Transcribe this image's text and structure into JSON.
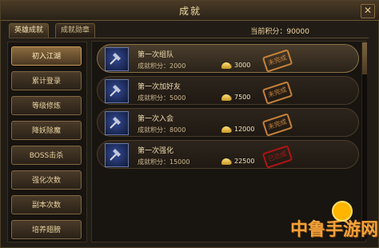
{
  "window": {
    "title": "成就"
  },
  "tabs": [
    {
      "label": "英雄成就"
    },
    {
      "label": "成就勋章"
    }
  ],
  "current_points": "当前积分：90000",
  "sidebar": {
    "items": [
      {
        "label": "初入江湖"
      },
      {
        "label": "累计登录"
      },
      {
        "label": "等级修炼"
      },
      {
        "label": "降妖除魔"
      },
      {
        "label": "BOSS击杀"
      },
      {
        "label": "强化次数"
      },
      {
        "label": "副本次数"
      },
      {
        "label": "培养翅膀"
      }
    ]
  },
  "achievements": [
    {
      "title": "第一次组队",
      "points": "成就积分：2000",
      "gold": "3000",
      "status": "未完成"
    },
    {
      "title": "第一次加好友",
      "points": "成就积分：5000",
      "gold": "7500",
      "status": "未完成"
    },
    {
      "title": "第一次入会",
      "points": "成就积分：8000",
      "gold": "12000",
      "status": "未完成"
    },
    {
      "title": "第一次强化",
      "points": "成就积分：15000",
      "gold": "22500",
      "status": "已达成"
    }
  ],
  "icons": {
    "achievement_icon": "hammer-icon",
    "reward_icon": "gold-icon",
    "close_icon": "close-icon"
  },
  "watermark": "中鲁手游网"
}
